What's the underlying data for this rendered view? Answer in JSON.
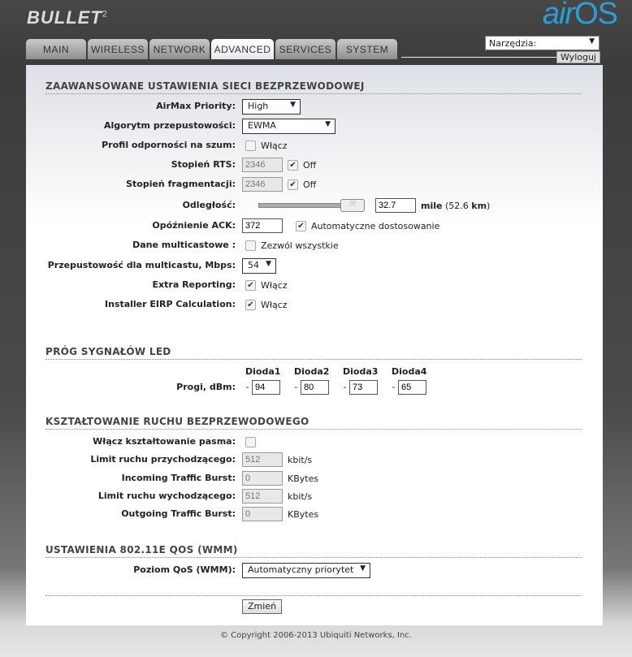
{
  "brand": {
    "logo": "BULLET",
    "logo_sup": "2",
    "os_logo": "airOS",
    "os_air": "air",
    "os_os": "OS"
  },
  "tabs": [
    "MAIN",
    "WIRELESS",
    "NETWORK",
    "ADVANCED",
    "SERVICES",
    "SYSTEM"
  ],
  "active_tab": "ADVANCED",
  "tools": {
    "label": "Narzędzia:",
    "logout": "Wyloguj"
  },
  "wireless": {
    "title": "ZAAWANSOWANE USTAWIENIA SIECI BEZPRZEWODOWEJ",
    "airmax_label": "AirMax Priority:",
    "airmax_value": "High",
    "algo_label": "Algorytm przepustowości:",
    "algo_value": "EWMA",
    "noise_label": "Profil odporności na szum:",
    "noise_text": "Włącz",
    "noise_checked": false,
    "rts_label": "Stopień RTS:",
    "rts_value": "2346",
    "rts_off": "Off",
    "rts_off_checked": true,
    "frag_label": "Stopień fragmentacji:",
    "frag_value": "2346",
    "frag_off": "Off",
    "frag_off_checked": true,
    "dist_label": "Odległość:",
    "dist_value": "32.7",
    "dist_unit": "mile",
    "dist_km_open": "(52.6",
    "dist_km_unit": "km",
    "dist_km_close": ")",
    "ack_label": "Opóźnienie ACK:",
    "ack_value": "372",
    "ack_auto": "Automatyczne dostosowanie",
    "ack_auto_checked": true,
    "mcast_label": "Dane multicastowe :",
    "mcast_text": "Zezwól wszystkie",
    "mcast_checked": false,
    "mrate_label": "Przepustowość dla multicastu, Mbps:",
    "mrate_value": "54",
    "extra_label": "Extra Reporting:",
    "extra_text": "Włącz",
    "extra_checked": true,
    "eirp_label": "Installer EIRP Calculation:",
    "eirp_text": "Włącz",
    "eirp_checked": true
  },
  "led": {
    "title": "PRÓG SYGNAŁÓW LED",
    "label": "Progi, dBm:",
    "minus": "-",
    "diodes": [
      {
        "name": "Dioda1",
        "value": "94"
      },
      {
        "name": "Dioda2",
        "value": "80"
      },
      {
        "name": "Dioda3",
        "value": "73"
      },
      {
        "name": "Dioda4",
        "value": "65"
      }
    ]
  },
  "shaping": {
    "title": "KSZTAŁTOWANIE RUCHU BEZPRZEWODOWEGO",
    "enable_label": "Włącz kształtowanie pasma:",
    "enable_checked": false,
    "in_limit_label": "Limit ruchu przychodzącego:",
    "in_limit": "512",
    "in_limit_unit": "kbit/s",
    "in_burst_label": "Incoming Traffic Burst:",
    "in_burst": "0",
    "in_burst_unit": "KBytes",
    "out_limit_label": "Limit ruchu wychodzącego:",
    "out_limit": "512",
    "out_limit_unit": "kbit/s",
    "out_burst_label": "Outgoing Traffic Burst:",
    "out_burst": "0",
    "out_burst_unit": "KBytes"
  },
  "qos": {
    "title": "USTAWIENIA 802.11E QOS (WMM)",
    "label": "Poziom QoS (WMM):",
    "value": "Automatyczny priorytet"
  },
  "change_button": "Zmień",
  "copyright": "© Copyright 2006-2013 Ubiquiti Networks, Inc."
}
